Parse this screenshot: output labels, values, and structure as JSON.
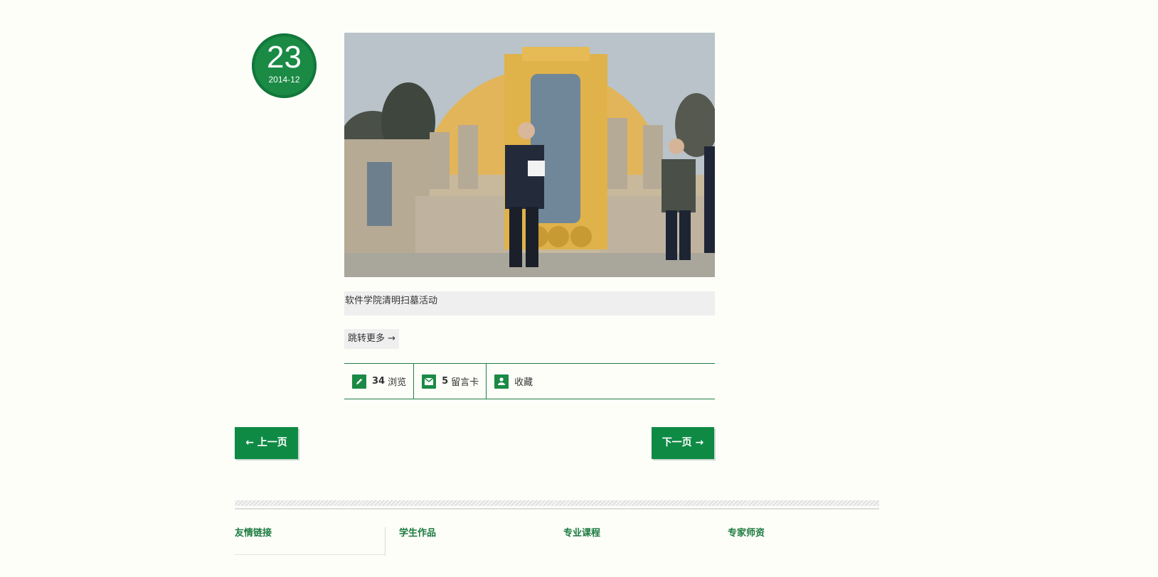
{
  "post": {
    "date": {
      "day": "23",
      "year_month": "2014-12"
    },
    "title": "软件学院清明扫墓活动",
    "more_label": "跳转更多 →",
    "stats": [
      {
        "icon": "pencil-icon",
        "count": "34",
        "label": "浏览"
      },
      {
        "icon": "envelope-icon",
        "count": "5",
        "label": "留言卡"
      },
      {
        "icon": "user-icon",
        "count": "",
        "label": "收藏"
      }
    ]
  },
  "pagination": {
    "prev_label": "← 上一页",
    "next_label": "下一页 →"
  },
  "footer": {
    "columns": [
      "友情链接",
      "学生作品",
      "专业课程",
      "专家师资"
    ]
  },
  "colors": {
    "accent": "#0f8a45",
    "border": "#1e7f45",
    "background": "#fefef9"
  }
}
